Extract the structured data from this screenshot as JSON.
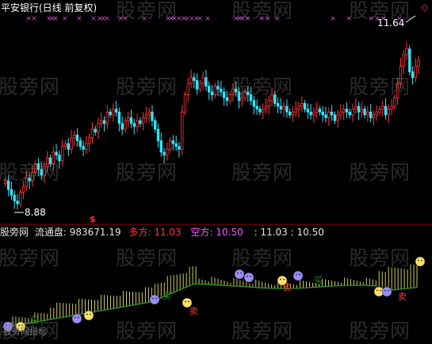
{
  "title": "平安银行(日线 前复权)",
  "corner_icon": "◇",
  "high_label": "11.64",
  "low_label": "8.88",
  "dollar_mark": "$",
  "indicator": {
    "name": "股旁网",
    "circulation_label": "流通盘:",
    "circulation_value": "983671.19",
    "long_label": "多方:",
    "long_value": "11.03",
    "short_label": "空方:",
    "short_value": "10.50",
    "pair_label": ":",
    "pair_value_1": "11.03",
    "pair_value_2": "10.50"
  },
  "bottom_text": "股旁网指标",
  "markers": {
    "buy": "买",
    "sell": "卖"
  },
  "watermark": "股旁网",
  "colors": {
    "up": "#ff3838",
    "down": "#33e5ff",
    "title": "#ffffff",
    "long": "#ff3838",
    "short": "#ff55ff",
    "cross": "#d64ad6",
    "divider": "#8b0000",
    "ribbon_up": "#ffff66",
    "ribbon_line": "#2e8b2e"
  },
  "chart_data": {
    "type": "candlestick",
    "title": "平安银行(日线 前复权)",
    "high": 11.64,
    "low": 8.88,
    "close_series": [
      9.3,
      9.15,
      9.05,
      8.95,
      8.9,
      9.1,
      9.2,
      9.35,
      9.3,
      9.45,
      9.6,
      9.5,
      9.4,
      9.55,
      9.7,
      9.6,
      9.8,
      9.75,
      9.65,
      9.9,
      9.95,
      9.85,
      10.05,
      10.1,
      10.0,
      9.9,
      9.85,
      9.95,
      10.05,
      10.2,
      10.15,
      10.3,
      10.35,
      10.3,
      10.5,
      10.45,
      10.55,
      10.5,
      10.3,
      10.2,
      10.35,
      10.4,
      10.3,
      10.25,
      10.35,
      10.3,
      10.4,
      10.45,
      10.5,
      10.35,
      10.2,
      10.0,
      9.8,
      9.75,
      9.85,
      10.0,
      9.95,
      9.9,
      9.85,
      10.5,
      10.8,
      11.0,
      11.1,
      11.05,
      10.9,
      11.0,
      11.1,
      10.95,
      10.85,
      10.8,
      10.95,
      10.9,
      10.85,
      10.75,
      10.7,
      10.8,
      10.9,
      10.85,
      10.7,
      10.75,
      10.85,
      10.8,
      10.7,
      10.6,
      10.55,
      10.5,
      10.55,
      10.6,
      10.7,
      10.8,
      10.65,
      10.6,
      10.55,
      10.6,
      10.5,
      10.45,
      10.5,
      10.55,
      10.6,
      10.65,
      10.55,
      10.5,
      10.45,
      10.5,
      10.55,
      10.5,
      10.45,
      10.4,
      10.5,
      10.45,
      10.35,
      10.45,
      10.5,
      10.55,
      10.5,
      10.45,
      10.55,
      10.6,
      10.5,
      10.55,
      10.45,
      10.5,
      10.4,
      10.45,
      10.5,
      10.55,
      10.6,
      10.45,
      10.55,
      10.6,
      10.75,
      11.0,
      11.3,
      11.5,
      11.6,
      11.2,
      11.1,
      11.3,
      11.4
    ]
  }
}
